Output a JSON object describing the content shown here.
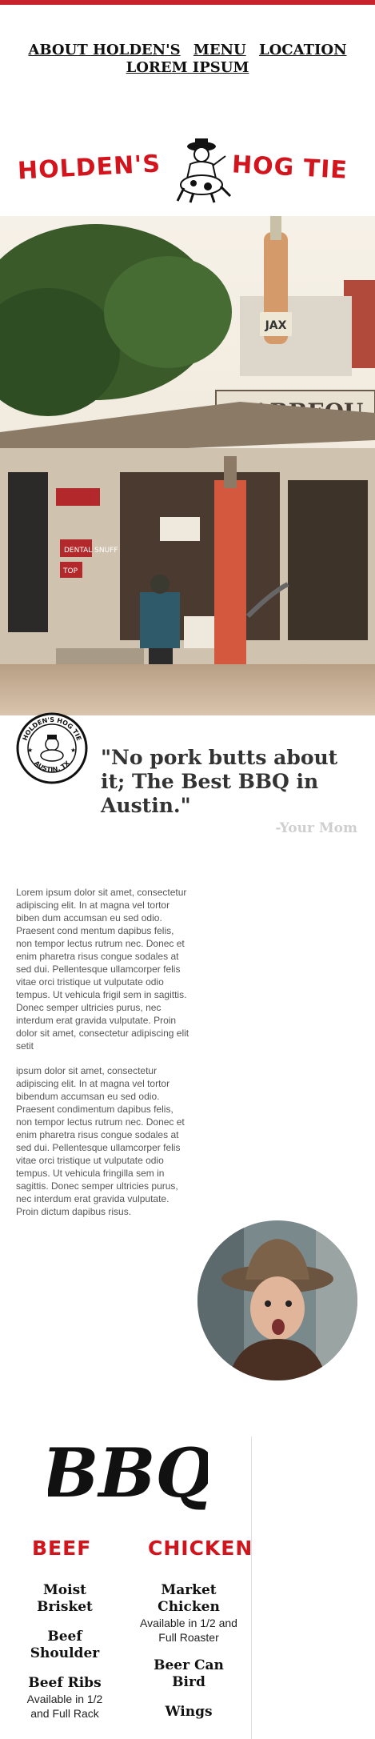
{
  "nav": {
    "items": [
      {
        "label": "ABOUT HOLDEN'S"
      },
      {
        "label": "MENU"
      },
      {
        "label": "LOCATION"
      },
      {
        "label": "LOREM IPSUM"
      }
    ]
  },
  "brand": {
    "left": "HOLDEN'S",
    "right": "HOG TIE",
    "color": "#d3141d"
  },
  "hero": {
    "signs": {
      "bottle": "JAX",
      "roof": "BARBEQU",
      "dental": "DENTAL SNUFF",
      "top": "TOP"
    }
  },
  "badge": {
    "top_text": "HOLDEN'S HOG TIE",
    "bottom_text": "AUSTIN, TX"
  },
  "quote": {
    "text": "\"No pork butts about it; The Best BBQ in Austin.\"",
    "author": "-Your Mom"
  },
  "about": {
    "paragraph1": "Lorem ipsum dolor sit amet, consectetur adipiscing elit. In at magna vel tortor biben dum accumsan eu sed odio. Praesent cond mentum dapibus felis, non tempor lectus rutrum nec. Donec et enim pharetra risus congue sodales at sed dui. Pellentesque ullamcorper felis vitae orci tristique ut vulputate odio tempus. Ut vehicula frigil sem in sagittis. Donec semper ultricies purus, nec interdum erat gravida vulputate. Proin dolor sit amet, consectetur adipiscing elit setit",
    "paragraph2": "ipsum dolor sit amet, consectetur adipiscing elit. In at magna vel tortor bibendum accumsan eu sed odio. Praesent condimentum dapibus felis, non tempor lectus rutrum nec. Donec et enim pharetra risus congue sodales at sed dui. Pellentesque ullamcorper felis vitae orci tristique ut vulputate odio tempus. Ut vehicula fringilla sem in sagittis. Donec semper ultricies purus, nec interdum erat gravida vulputate. Proin dictum dapibus risus."
  },
  "menu": {
    "heading": "BBQ",
    "beef": {
      "title": "BEEF",
      "items": [
        {
          "name": "Moist Brisket",
          "note": ""
        },
        {
          "name": "Beef Shoulder",
          "note": ""
        },
        {
          "name": "Beef Ribs",
          "note": "Available in 1/2 and Full Rack"
        }
      ]
    },
    "chicken": {
      "title": "CHICKEN",
      "items": [
        {
          "name": "Market Chicken",
          "note": "Available in 1/2 and Full Roaster"
        },
        {
          "name": "Beer Can Bird",
          "note": ""
        },
        {
          "name": "Wings",
          "note": ""
        }
      ]
    }
  },
  "colors": {
    "accent": "#c8232c",
    "brand_red": "#d3141d",
    "quote_text": "#333333",
    "author": "#cfcfcf"
  }
}
